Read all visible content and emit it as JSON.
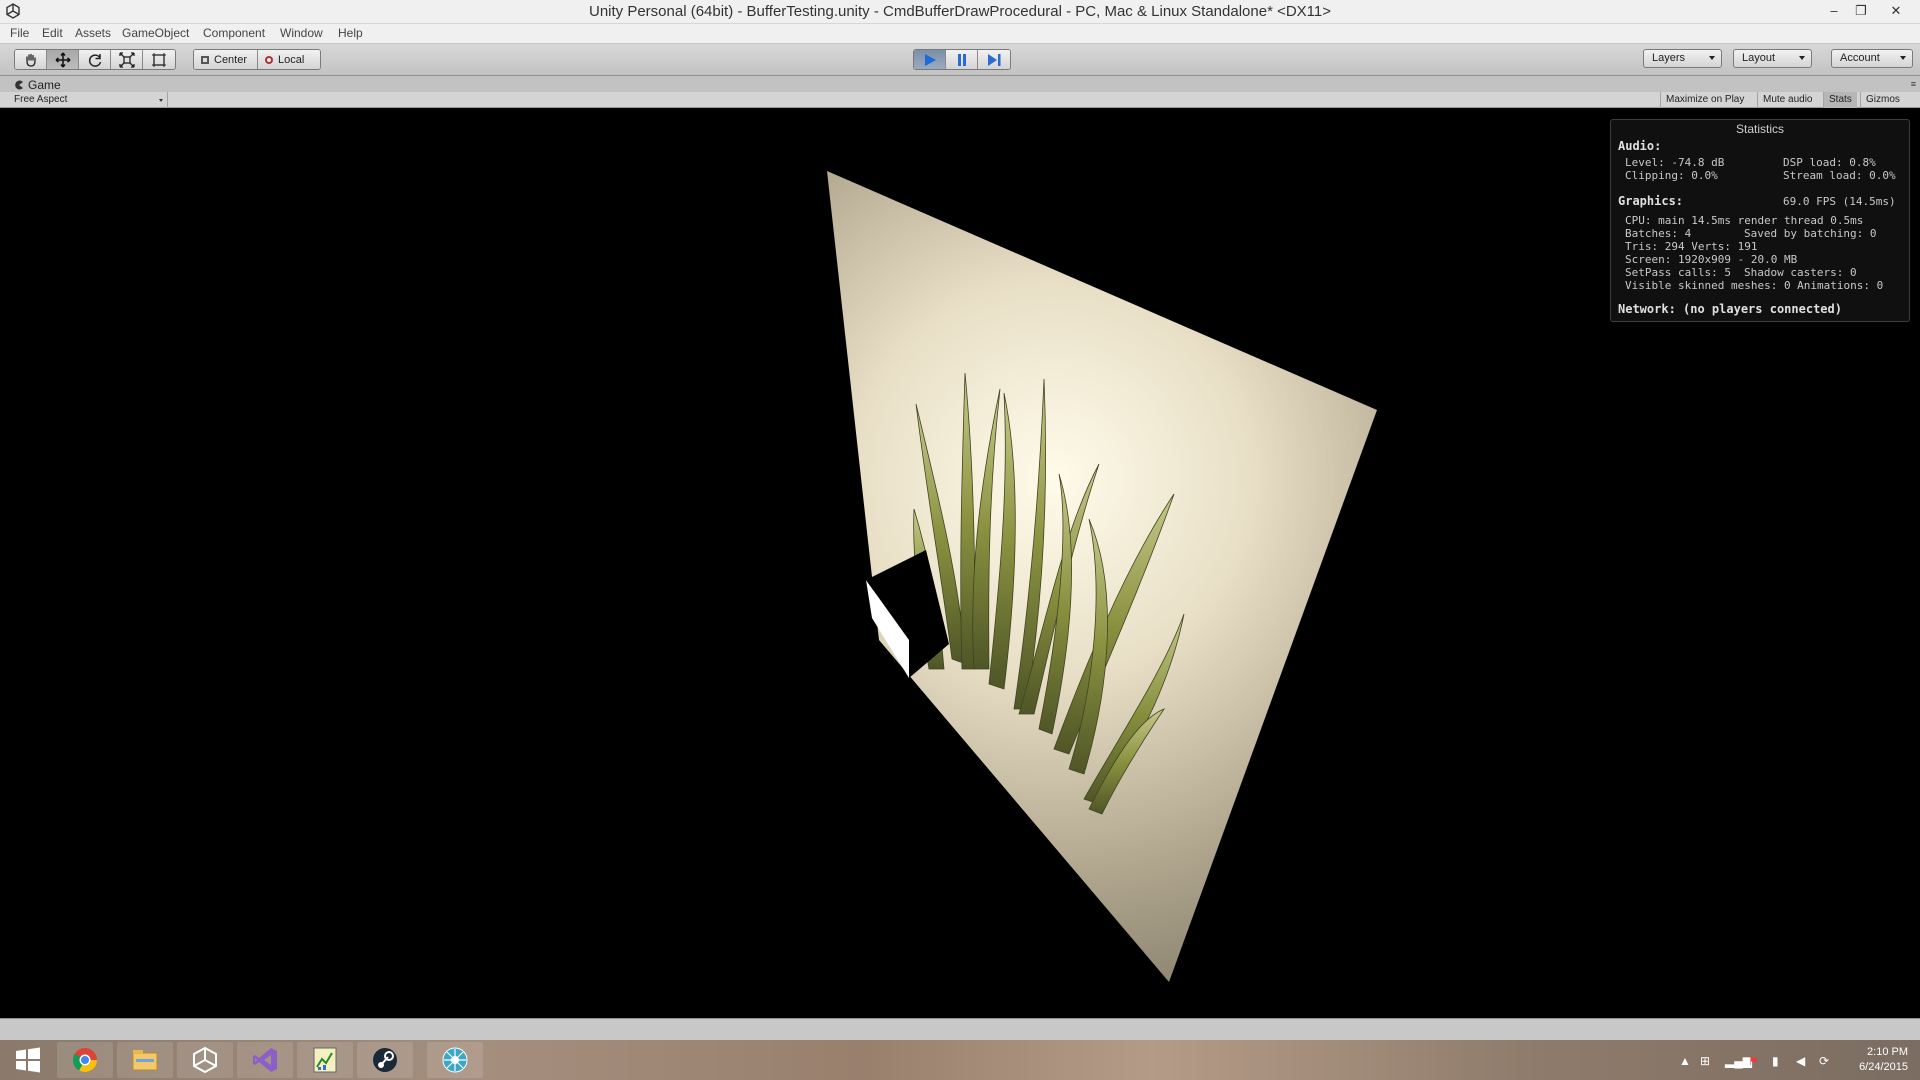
{
  "window": {
    "title": "Unity Personal (64bit) - BufferTesting.unity - CmdBufferDrawProcedural - PC, Mac & Linux Standalone* <DX11>",
    "minimize_glyph": "–",
    "restore_glyph": "❐",
    "close_glyph": "✕"
  },
  "menu": [
    "File",
    "Edit",
    "Assets",
    "GameObject",
    "Component",
    "Window",
    "Help"
  ],
  "toolbar": {
    "tools": [
      "hand-icon",
      "move-icon",
      "rotate-icon",
      "scale-icon",
      "rect-icon"
    ],
    "active_tool": "move-icon",
    "pivot": "Center",
    "space": "Local",
    "play_state": "playing",
    "layers": "Layers",
    "layout": "Layout",
    "account": "Account"
  },
  "game_view": {
    "tab": "Game",
    "aspect": "Free Aspect",
    "buttons": [
      "Maximize on Play",
      "Mute audio",
      "Stats",
      "Gizmos"
    ],
    "active_button": "Stats"
  },
  "stats": {
    "title": "Statistics",
    "audio_header": "Audio:",
    "level": "Level: -74.8 dB",
    "clipping": "Clipping: 0.0%",
    "dsp_load": "DSP load: 0.8%",
    "stream_load": "Stream load: 0.0%",
    "graphics_header": "Graphics:",
    "fps": "69.0 FPS (14.5ms)",
    "cpu": "CPU: main 14.5ms  render thread 0.5ms",
    "batches": "Batches: 4",
    "saved_batching": "Saved by batching: 0",
    "tris": "Tris: 294  Verts: 191",
    "screen": "Screen: 1920x909 - 20.0 MB",
    "setpass": "SetPass calls: 5",
    "shadow_casters": "Shadow casters: 0",
    "skinned": "Visible skinned meshes: 0  Animations: 0",
    "network": "Network: (no players connected)"
  },
  "taskbar": {
    "apps": [
      "windows-start-icon",
      "chrome-icon",
      "file-explorer-icon",
      "unity-icon",
      "visual-studio-icon",
      "chart-app-icon",
      "steam-icon",
      "network-app-icon"
    ],
    "time": "2:10 PM",
    "date": "6/24/2015"
  },
  "colors": {
    "accent_play": "#3a7bd5",
    "panel": "#c2c2c2",
    "viewport": "#000000"
  }
}
